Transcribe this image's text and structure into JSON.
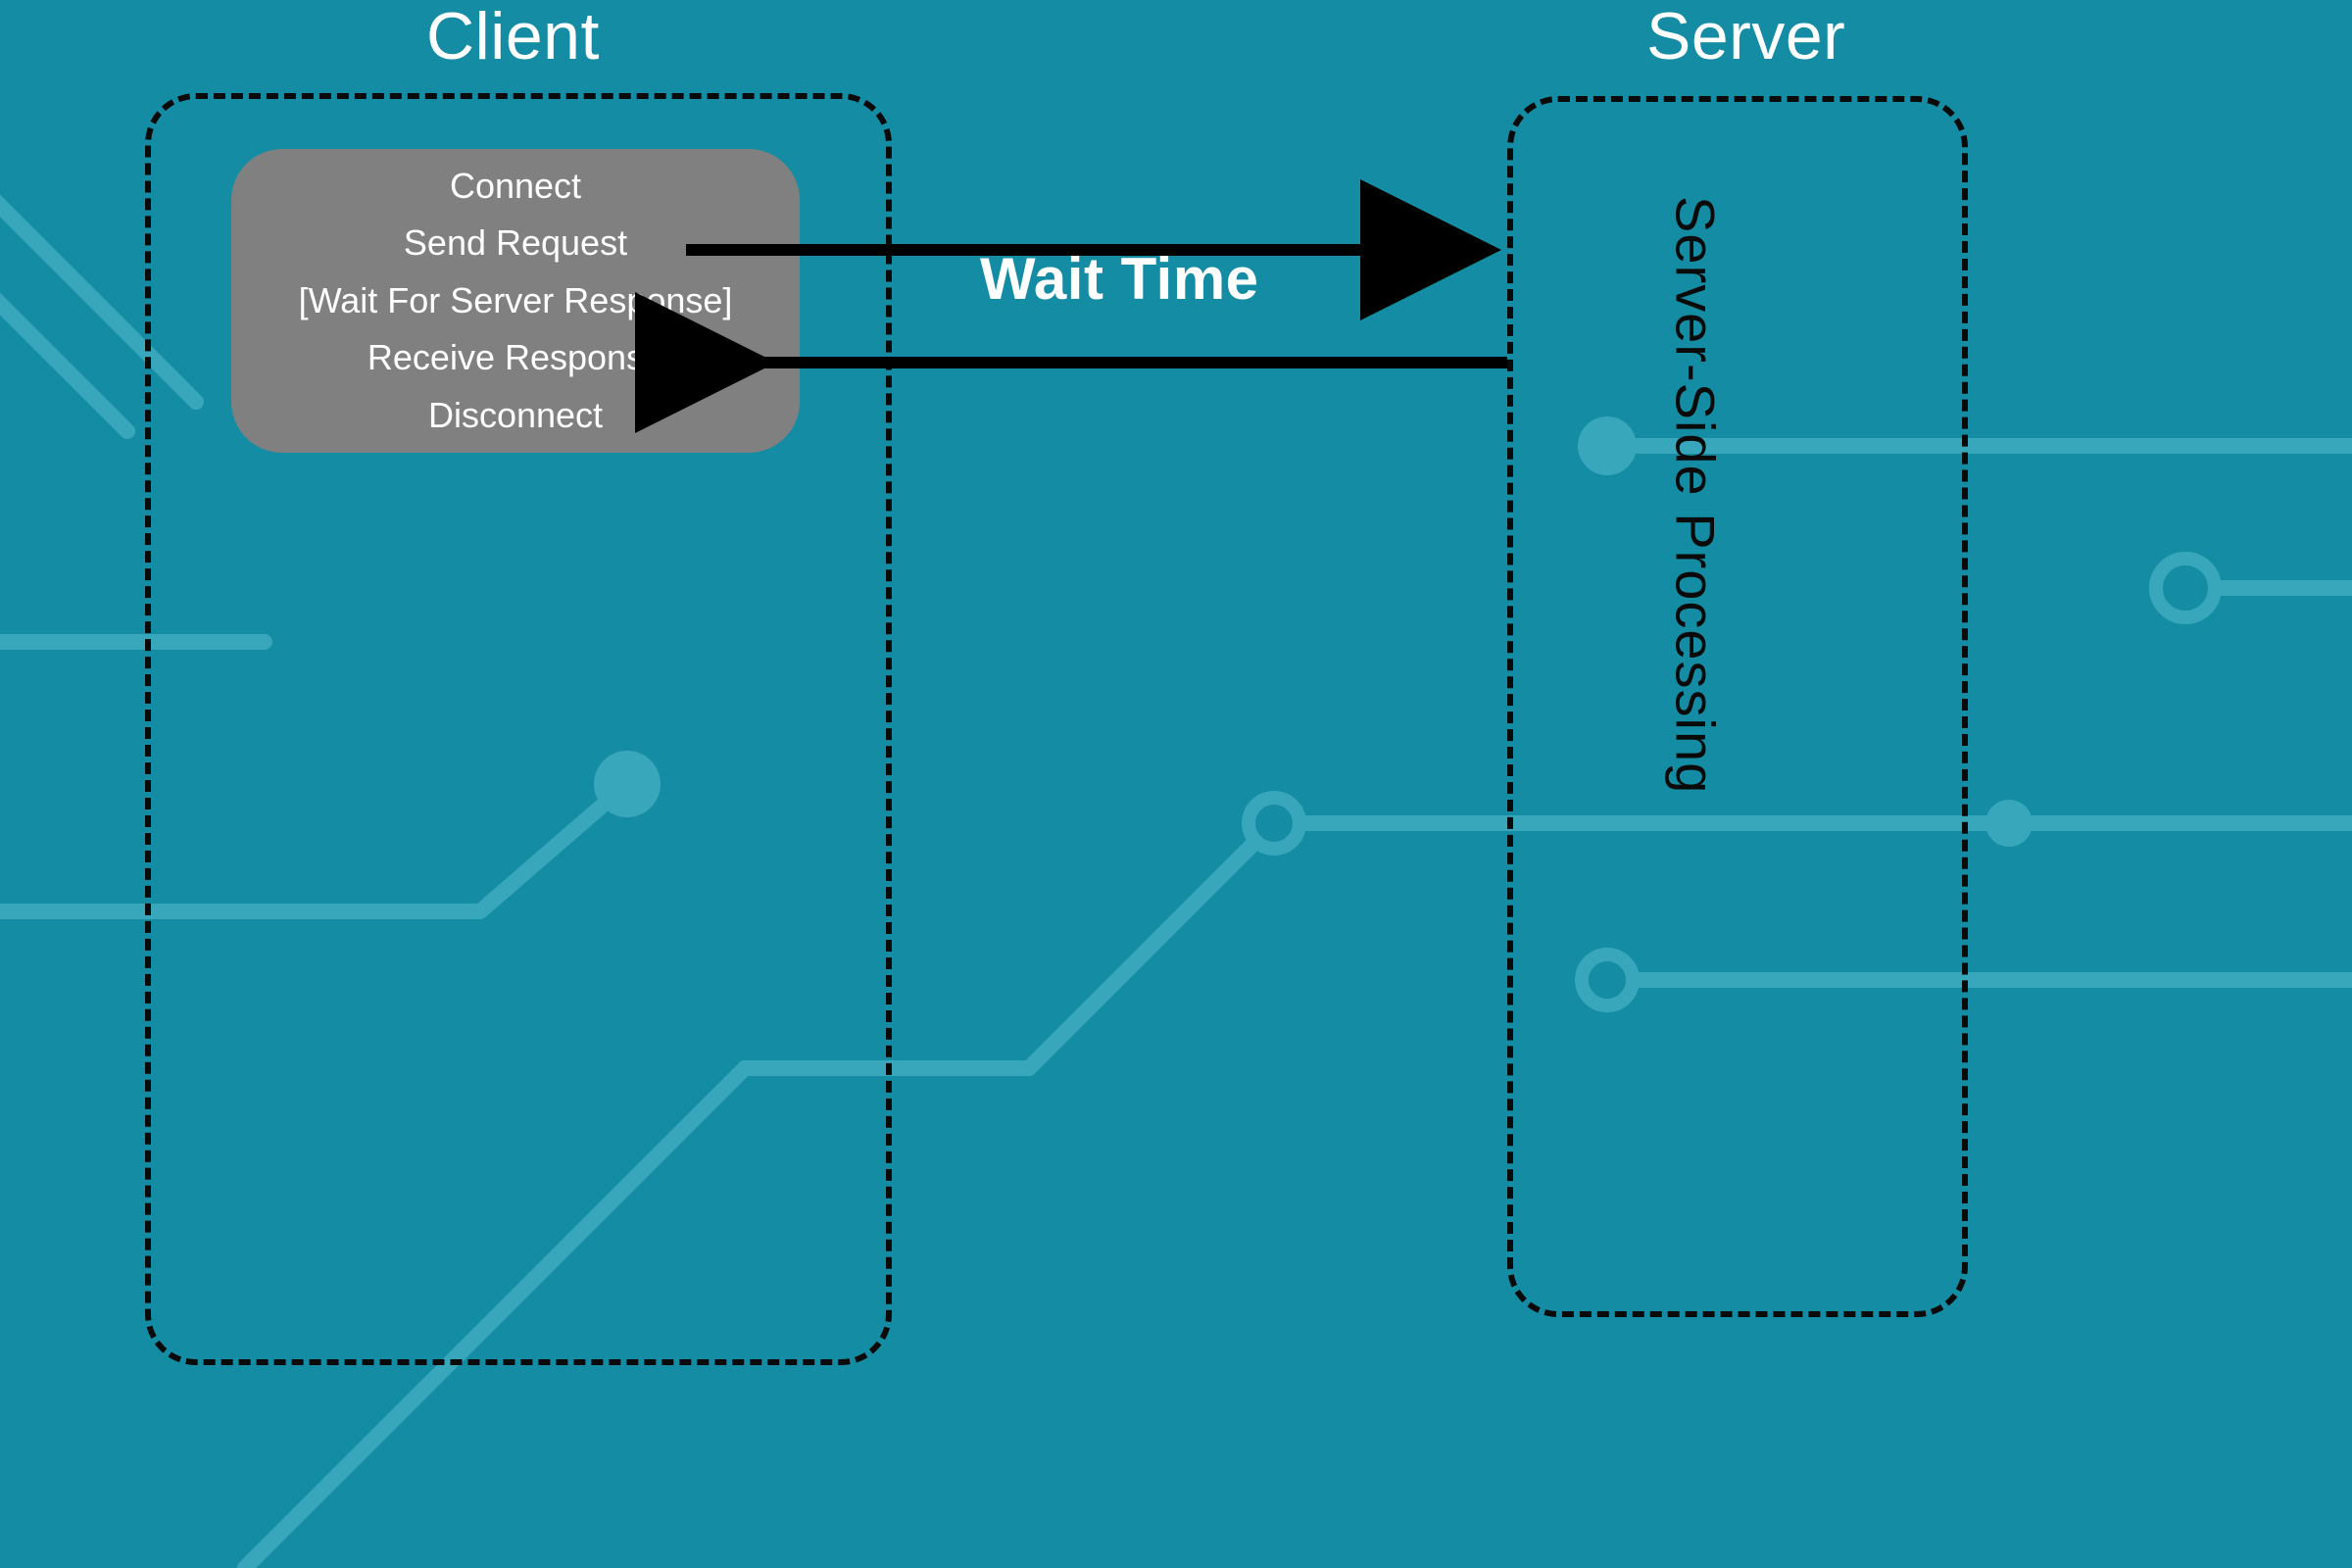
{
  "titles": {
    "client": "Client",
    "server": "Server"
  },
  "client": {
    "steps": {
      "connect": "Connect",
      "send": "Send Request",
      "wait": "[Wait For Server Response]",
      "receive": "Receive Response",
      "disconnect": "Disconnect"
    }
  },
  "server": {
    "label": "Server-Side Processing"
  },
  "arrows": {
    "wait_label": "Wait Time"
  },
  "colors": {
    "background": "#148ca3",
    "trace": "#39a7bb",
    "panel": "#808080",
    "border": "#0a0a0a",
    "text_light": "#ffffff",
    "text_dark": "#0a0a0a"
  }
}
